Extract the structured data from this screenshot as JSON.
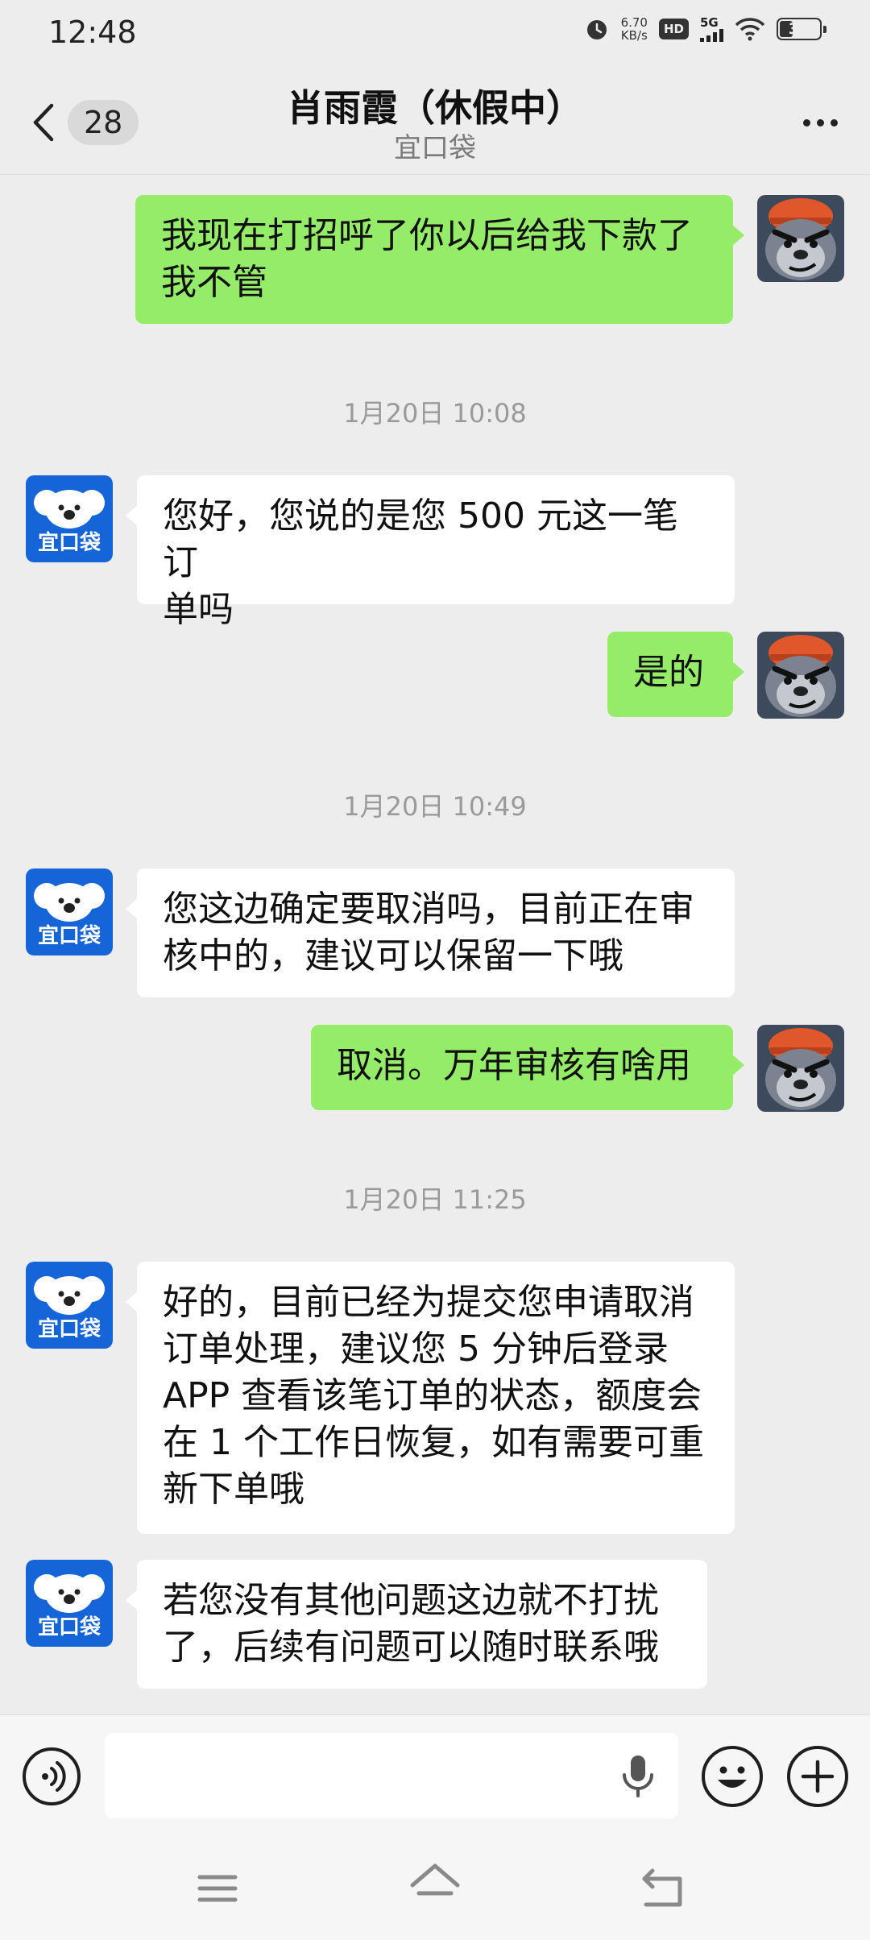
{
  "status_bar": {
    "time": "12:48",
    "net_speed_value": "6.70",
    "net_speed_unit": "KB/s",
    "hd_label": "HD",
    "signal_label": "5G",
    "battery": "31",
    "icons": [
      "alarm-icon",
      "hd-icon",
      "signal-icon",
      "wifi-icon",
      "battery-icon"
    ]
  },
  "header": {
    "back_icon": "chevron-left-icon",
    "unread_count": "28",
    "title": "肖雨霞（休假中）",
    "subtitle": "宜口袋",
    "more_icon": "more-dots-icon"
  },
  "contact_avatar": {
    "top_text": "",
    "label": "宜口袋",
    "bg_color": "#1565d8"
  },
  "messages": [
    {
      "from": "me",
      "lines": [
        "我现在打招呼了你以后给我下款了",
        "我不管"
      ]
    },
    {
      "type": "timestamp",
      "text": "1月20日 10:08"
    },
    {
      "from": "them",
      "lines": [
        "您好，您说的是您 500 元这一笔订",
        "单吗"
      ]
    },
    {
      "from": "me",
      "lines": [
        "是的"
      ]
    },
    {
      "type": "timestamp",
      "text": "1月20日 10:49"
    },
    {
      "from": "them",
      "lines": [
        "您这边确定要取消吗，目前正在审",
        "核中的，建议可以保留一下哦"
      ]
    },
    {
      "from": "me",
      "lines": [
        "取消。万年审核有啥用"
      ]
    },
    {
      "type": "timestamp",
      "text": "1月20日 11:25"
    },
    {
      "from": "them",
      "lines": [
        "好的，目前已经为提交您申请取消",
        "订单处理，建议您 5 分钟后登录",
        "APP 查看该笔订单的状态，额度会",
        "在 1 个工作日恢复，如有需要可重",
        "新下单哦"
      ]
    },
    {
      "from": "them",
      "lines": [
        "若您没有其他问题这边就不打扰",
        "了，后续有问题可以随时联系哦"
      ]
    }
  ],
  "input_bar": {
    "input_value": "",
    "icons": [
      "voice-icon",
      "microphone-icon",
      "emoji-icon",
      "plus-icon"
    ]
  },
  "system_nav": {
    "icons": [
      "menu-icon",
      "home-icon",
      "back-icon"
    ]
  },
  "colors": {
    "my_bubble": "#95ec69",
    "their_bubble": "#ffffff",
    "background": "#ededed"
  }
}
